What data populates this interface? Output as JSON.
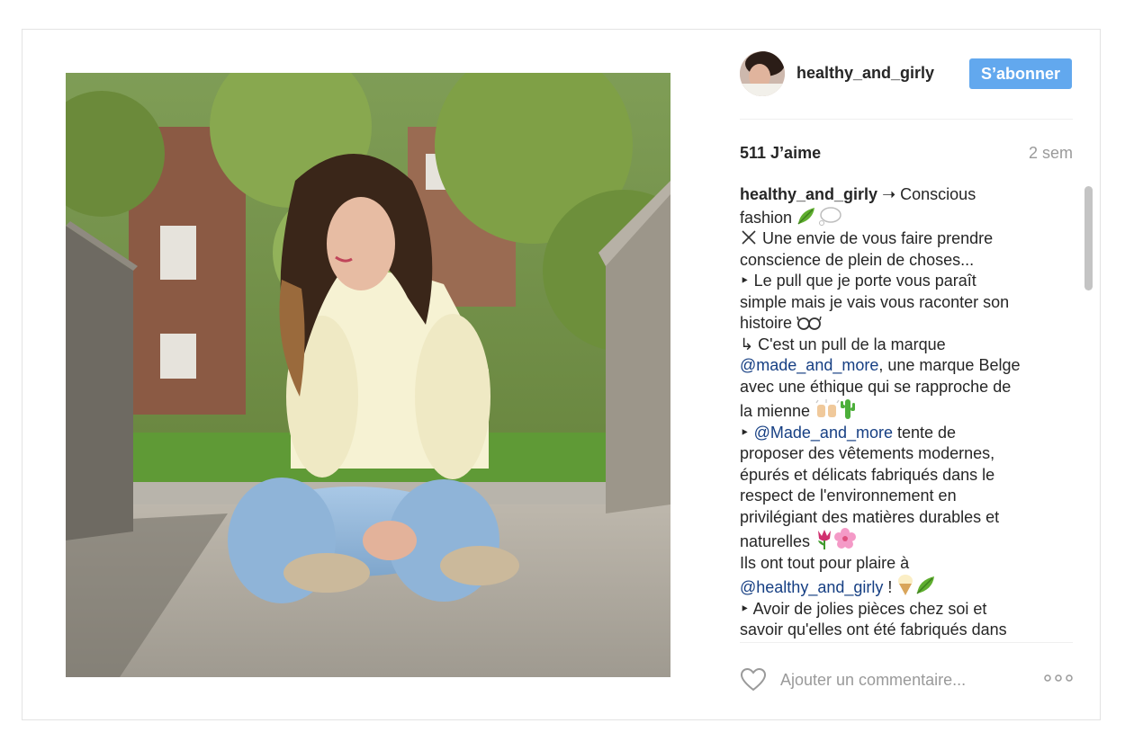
{
  "post": {
    "username": "healthy_and_girly",
    "follow_label": "S’abonner",
    "likes": "511 J’aime",
    "time_ago": "2 sem",
    "caption_lines": [
      {
        "author": "healthy_and_girly",
        "text": " ➝ Conscious"
      },
      {
        "text": "fashion "
      },
      {
        "text": " Une envie de vous faire prendre"
      },
      {
        "text": "conscience de plein de choses..."
      },
      {
        "text": "‣ Le pull que je porte vous paraît"
      },
      {
        "text": "simple mais je vais vous raconter son"
      },
      {
        "text": "histoire "
      },
      {
        "text": "↳ C'est un pull de la marque"
      },
      {
        "mention": "@made_and_more",
        "text": ", une marque Belge"
      },
      {
        "text": "avec une éthique qui se rapproche de"
      },
      {
        "text": "la mienne "
      },
      {
        "text": "‣ ",
        "mention": "@Made_and_more",
        "after": " tente de"
      },
      {
        "text": "proposer des vêtements modernes,"
      },
      {
        "text": "épurés et délicats fabriqués dans le"
      },
      {
        "text": "respect de l'environnement en"
      },
      {
        "text": "privilégiant des matières durables et"
      },
      {
        "text": "naturelles "
      },
      {
        "text": "Ils ont tout pour plaire à"
      },
      {
        "mention": "@healthy_and_girly",
        "text": " ! "
      },
      {
        "text": "‣ Avoir de jolies pièces chez soi et"
      },
      {
        "text": "savoir qu'elles ont été fabriqués dans"
      }
    ]
  },
  "comment": {
    "placeholder": "Ajouter un commentaire..."
  },
  "icons": {
    "like": "heart-outline-icon",
    "more": "more-options-icon"
  },
  "colors": {
    "follow_button": "#62a8ee",
    "mention": "#163f83",
    "muted": "#9a9a9a"
  }
}
